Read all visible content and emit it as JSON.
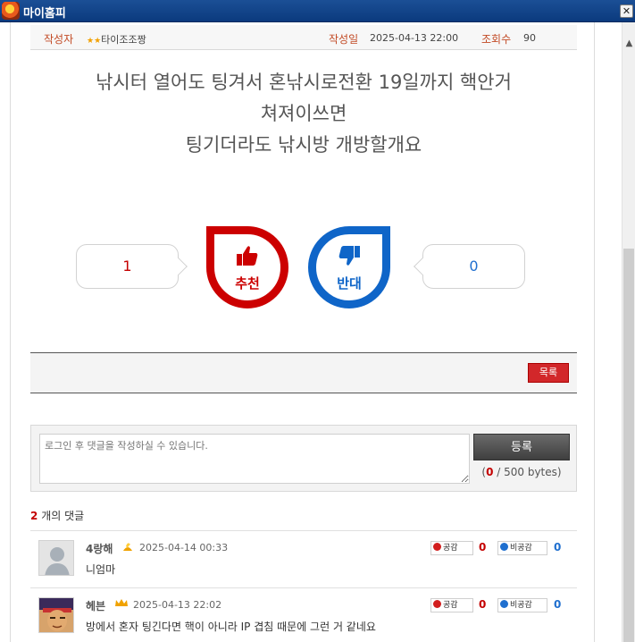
{
  "window": {
    "title": "마이홈피",
    "close_label": "✕"
  },
  "post": {
    "author_label": "작성자",
    "author_name": "타이조조짱",
    "author_stars": "★★",
    "date_label": "작성일",
    "date_value": "2025-04-13 22:00",
    "views_label": "조회수",
    "views_value": "90",
    "title_lines": [
      "낚시터 열어도 팅겨서 혼낚시로전환 19일까지 핵안거",
      "쳐져이쓰면",
      "팅기더라도 낚시방 개방할개요"
    ]
  },
  "votes": {
    "up_count": "1",
    "up_label": "추천",
    "down_count": "0",
    "down_label": "반대"
  },
  "actions": {
    "list_label": "목록"
  },
  "comment_form": {
    "placeholder": "로그인 후 댓글을 작성하실 수 있습니다.",
    "submit_label": "등록",
    "byte_used": "0",
    "byte_limit": "/ 500 bytes)",
    "byte_open": "("
  },
  "comment_summary": {
    "count": "2",
    "suffix": "개의 댓글"
  },
  "comments": [
    {
      "author": "4랑해",
      "level_icon": "level-flame-icon",
      "time": "2025-04-14 00:33",
      "body": "니엄마",
      "like_label": "공감",
      "like_count": "0",
      "dislike_label": "비공감",
      "dislike_count": "0"
    },
    {
      "author": "헤븐",
      "level_icon": "level-crown-icon",
      "time": "2025-04-13 22:02",
      "body": "방에서 혼자 팅긴다면 핵이 아니라 IP 겹침 때문에 그런 거 같네요",
      "like_label": "공감",
      "like_count": "0",
      "dislike_label": "비공감",
      "dislike_count": "0"
    }
  ],
  "colors": {
    "accent_red": "#cc0000",
    "accent_blue": "#0f65c8",
    "titlebar": "#0b3a7e"
  }
}
